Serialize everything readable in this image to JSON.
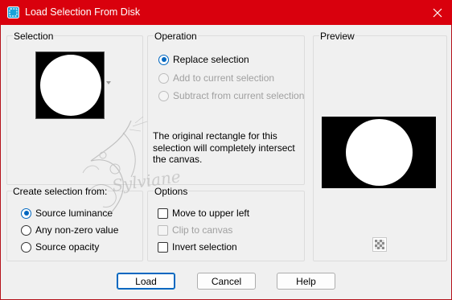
{
  "window": {
    "title": "Load Selection From Disk",
    "close_icon": "close-icon",
    "app_icon": "selection-icon"
  },
  "selection_group": {
    "label": "Selection"
  },
  "operation_group": {
    "label": "Operation",
    "options": [
      {
        "label": "Replace selection",
        "checked": true,
        "enabled": true
      },
      {
        "label": "Add to current selection",
        "checked": false,
        "enabled": false
      },
      {
        "label": "Subtract from current selection",
        "checked": false,
        "enabled": false
      }
    ],
    "info": "The original rectangle for this selection will completely intersect the canvas."
  },
  "preview_group": {
    "label": "Preview",
    "toggle_icon": "transparency-grid-icon"
  },
  "create_from_group": {
    "label": "Create selection from:",
    "options": [
      {
        "label": "Source luminance",
        "checked": true
      },
      {
        "label": "Any non-zero value",
        "checked": false
      },
      {
        "label": "Source opacity",
        "checked": false
      }
    ]
  },
  "options_group": {
    "label": "Options",
    "checks": [
      {
        "label": "Move to upper left",
        "checked": false,
        "enabled": true
      },
      {
        "label": "Clip to canvas",
        "checked": false,
        "enabled": false
      },
      {
        "label": "Invert selection",
        "checked": false,
        "enabled": true
      }
    ]
  },
  "buttons": {
    "load": "Load",
    "cancel": "Cancel",
    "help": "Help"
  },
  "watermark": {
    "text": "Sylviane"
  },
  "colors": {
    "titlebar": "#d9000d",
    "accent": "#0067c0"
  }
}
